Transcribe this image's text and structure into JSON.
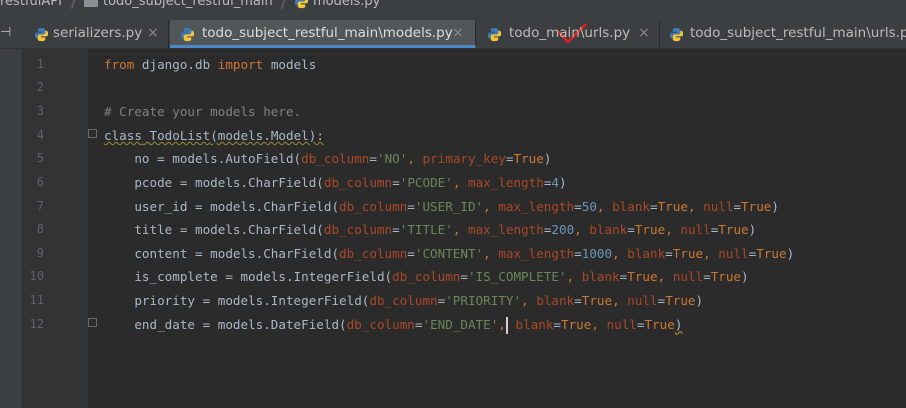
{
  "breadcrumb": [
    {
      "label": "restfulAPI"
    },
    {
      "label": "todo_subject_restful_main"
    },
    {
      "label": "models.py"
    }
  ],
  "tabs": [
    {
      "label": "serializers.py",
      "close": "×"
    },
    {
      "label": "todo_subject_restful_main\\models.py",
      "close": "×"
    },
    {
      "label": "todo_main\\urls.py",
      "close": "×"
    },
    {
      "label": "todo_subject_restful_main\\urls.py",
      "close": "×"
    }
  ],
  "tab_scroll_glyph": "⊣",
  "line_numbers": [
    "1",
    "2",
    "3",
    "4",
    "5",
    "6",
    "7",
    "8",
    "9",
    "10",
    "11",
    "12"
  ],
  "code": {
    "l1": {
      "k1": "from",
      "t1": " django.db ",
      "k2": "import",
      "t2": " models"
    },
    "l3": {
      "c": "# Create your models here."
    },
    "l4": {
      "k": "class",
      "sp": " ",
      "name": "TodoList",
      "t": "(models.Model):"
    },
    "l5": {
      "a": "    no = models.AutoField(",
      "k1": "db_column",
      "e1": "=",
      "s1": "'NO'",
      "c1": ", ",
      "k2": "primary_key",
      "e2": "=",
      "v2": "True",
      "z": ")"
    },
    "l6": {
      "a": "    pcode = models.CharField(",
      "k1": "db_column",
      "e1": "=",
      "s1": "'PCODE'",
      "c1": ", ",
      "k2": "max_length",
      "e2": "=",
      "n2": "4",
      "z": ")"
    },
    "l7": {
      "a": "    user_id = models.CharField(",
      "k1": "db_column",
      "e1": "=",
      "s1": "'USER_ID'",
      "c1": ", ",
      "k2": "max_length",
      "e2": "=",
      "n2": "50",
      "c2": ", ",
      "k3": "blank",
      "e3": "=",
      "v3": "True",
      "c3": ", ",
      "k4": "null",
      "e4": "=",
      "v4": "True",
      "z": ")"
    },
    "l8": {
      "a": "    title = models.CharField(",
      "k1": "db_column",
      "e1": "=",
      "s1": "'TITLE'",
      "c1": ", ",
      "k2": "max_length",
      "e2": "=",
      "n2": "200",
      "c2": ", ",
      "k3": "blank",
      "e3": "=",
      "v3": "True",
      "c3": ", ",
      "k4": "null",
      "e4": "=",
      "v4": "True",
      "z": ")"
    },
    "l9": {
      "a": "    content = models.CharField(",
      "k1": "db_column",
      "e1": "=",
      "s1": "'CONTENT'",
      "c1": ", ",
      "k2": "max_length",
      "e2": "=",
      "n2": "1000",
      "c2": ", ",
      "k3": "blank",
      "e3": "=",
      "v3": "True",
      "c3": ", ",
      "k4": "null",
      "e4": "=",
      "v4": "True",
      "z": ")"
    },
    "l10": {
      "a": "    is_complete = models.IntegerField(",
      "k1": "db_column",
      "e1": "=",
      "s1": "'IS_COMPLETE'",
      "c1": ", ",
      "k3": "blank",
      "e3": "=",
      "v3": "True",
      "c3": ", ",
      "k4": "null",
      "e4": "=",
      "v4": "True",
      "z": ")"
    },
    "l11": {
      "a": "    priority = models.IntegerField(",
      "k1": "db_column",
      "e1": "=",
      "s1": "'PRIORITY'",
      "c1": ", ",
      "k3": "blank",
      "e3": "=",
      "v3": "True",
      "c3": ", ",
      "k4": "null",
      "e4": "=",
      "v4": "True",
      "z": ")"
    },
    "l12": {
      "a": "    end_date = models.DateField(",
      "k1": "db_column",
      "e1": "=",
      "s1": "'END_DATE'",
      "c1": ",",
      "c1b": " ",
      "k3": "blank",
      "e3": "=",
      "v3": "True",
      "c3": ", ",
      "k4": "null",
      "e4": "=",
      "v4": "True",
      "z": ")"
    }
  },
  "colors": {
    "keyword": "#cc7832",
    "string": "#6a8759",
    "number": "#6897bb",
    "comment": "#808080",
    "kwarg": "#aa4926",
    "text": "#a9b7c6",
    "accent": "#4a88c7",
    "annotation": "#e02020"
  }
}
